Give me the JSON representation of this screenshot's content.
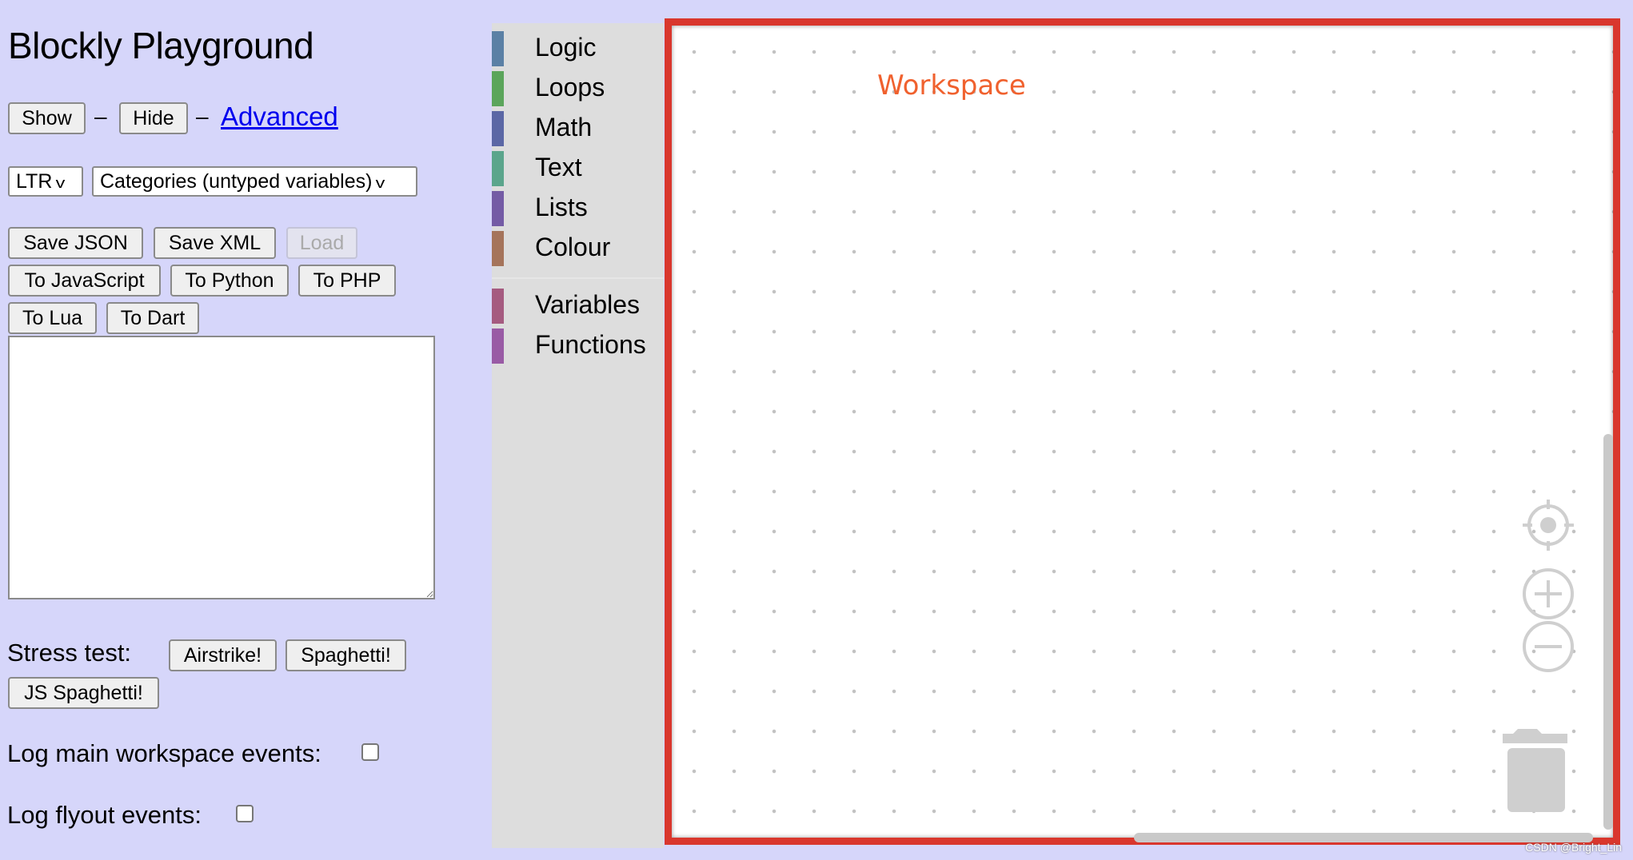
{
  "title": "Blockly Playground",
  "nav": {
    "show": "Show",
    "hide": "Hide",
    "separator": "–",
    "advanced": "Advanced"
  },
  "selects": {
    "direction": "LTR",
    "toolbox": "Categories (untyped variables)"
  },
  "buttons": {
    "save_json": "Save JSON",
    "save_xml": "Save XML",
    "load": "Load",
    "to_js": "To JavaScript",
    "to_python": "To Python",
    "to_php": "To PHP",
    "to_lua": "To Lua",
    "to_dart": "To Dart"
  },
  "output_textarea": {
    "value": ""
  },
  "stress": {
    "label": "Stress test:",
    "airstrike": "Airstrike!",
    "spaghetti": "Spaghetti!",
    "js_spaghetti": "JS Spaghetti!"
  },
  "log": {
    "main_label": "Log main workspace events:",
    "main_checked": false,
    "flyout_label": "Log flyout events:",
    "flyout_checked": false
  },
  "toolbox": {
    "categories": [
      {
        "label": "Logic",
        "color": "#5b80a5"
      },
      {
        "label": "Loops",
        "color": "#5ba55b"
      },
      {
        "label": "Math",
        "color": "#5b67a5"
      },
      {
        "label": "Text",
        "color": "#5ba58c"
      },
      {
        "label": "Lists",
        "color": "#745ba5"
      },
      {
        "label": "Colour",
        "color": "#a5745b"
      },
      {
        "label": "Variables",
        "color": "#a55b80"
      },
      {
        "label": "Functions",
        "color": "#995ba5"
      }
    ]
  },
  "workspace": {
    "label": "Workspace",
    "label_color": "#f0612e",
    "border_color": "#d9372d"
  },
  "watermark": "CSDN @Bright_Lin"
}
